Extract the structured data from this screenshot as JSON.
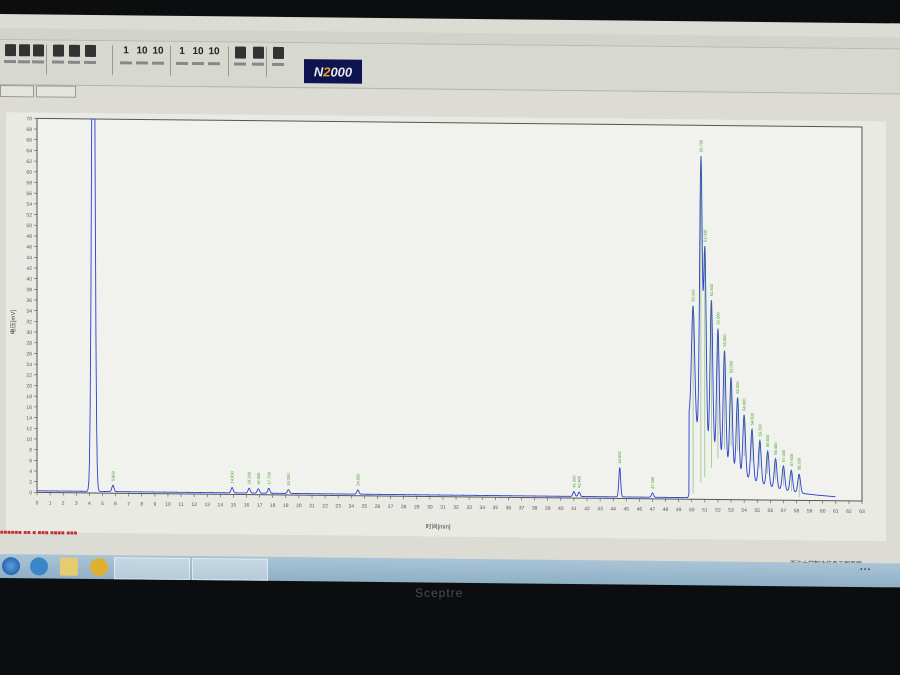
{
  "app": {
    "logo": "N2000"
  },
  "tabs": [
    "",
    ""
  ],
  "chart_data": {
    "type": "line",
    "xlabel": "时间[min]",
    "ylabel": "电压[mV]",
    "xlim": [
      0,
      63
    ],
    "ylim": [
      0,
      70
    ],
    "xticks": [
      0,
      1,
      2,
      3,
      4,
      5,
      6,
      7,
      8,
      9,
      10,
      11,
      12,
      13,
      14,
      15,
      16,
      17,
      18,
      19,
      20,
      21,
      22,
      23,
      24,
      25,
      26,
      27,
      28,
      29,
      30,
      31,
      32,
      33,
      34,
      35,
      36,
      37,
      38,
      39,
      40,
      41,
      42,
      43,
      44,
      45,
      46,
      47,
      48,
      49,
      50,
      51,
      52,
      53,
      54,
      55,
      56,
      57,
      58,
      59,
      60,
      61,
      62,
      63
    ],
    "ytick_step": 2,
    "line_color": "#2c3fd0",
    "label_color": "#3a9a20",
    "peaks": [
      {
        "rt": 4.3,
        "height": 120,
        "width": 0.12
      },
      {
        "rt": 5.8,
        "height": 1.2,
        "width": 0.08
      },
      {
        "rt": 14.9,
        "height": 1.0,
        "width": 0.08
      },
      {
        "rt": 16.2,
        "height": 0.9,
        "width": 0.08
      },
      {
        "rt": 16.9,
        "height": 0.8,
        "width": 0.08
      },
      {
        "rt": 17.7,
        "height": 0.9,
        "width": 0.08
      },
      {
        "rt": 19.2,
        "height": 0.7,
        "width": 0.08
      },
      {
        "rt": 24.5,
        "height": 0.8,
        "width": 0.08
      },
      {
        "rt": 41.0,
        "height": 0.9,
        "width": 0.08
      },
      {
        "rt": 41.4,
        "height": 0.8,
        "width": 0.08
      },
      {
        "rt": 44.5,
        "height": 5.5,
        "width": 0.07
      },
      {
        "rt": 47.0,
        "height": 0.8,
        "width": 0.08
      },
      {
        "rt": 50.1,
        "height": 22,
        "width": 0.12
      },
      {
        "rt": 50.7,
        "height": 52,
        "width": 0.1
      },
      {
        "rt": 51.0,
        "height": 36,
        "width": 0.1
      },
      {
        "rt": 51.5,
        "height": 28,
        "width": 0.1
      },
      {
        "rt": 52.0,
        "height": 24,
        "width": 0.1
      },
      {
        "rt": 52.5,
        "height": 21,
        "width": 0.1
      },
      {
        "rt": 53.0,
        "height": 17,
        "width": 0.1
      },
      {
        "rt": 53.5,
        "height": 14,
        "width": 0.1
      },
      {
        "rt": 54.0,
        "height": 11.5,
        "width": 0.1
      },
      {
        "rt": 54.6,
        "height": 9.5,
        "width": 0.1
      },
      {
        "rt": 55.2,
        "height": 8,
        "width": 0.1
      },
      {
        "rt": 55.8,
        "height": 6.5,
        "width": 0.1
      },
      {
        "rt": 56.4,
        "height": 5.5,
        "width": 0.1
      },
      {
        "rt": 57.0,
        "height": 4.5,
        "width": 0.1
      },
      {
        "rt": 57.6,
        "height": 4,
        "width": 0.1
      },
      {
        "rt": 58.2,
        "height": 3.5,
        "width": 0.1
      }
    ]
  },
  "taskbar": {
    "corp_text": "浙江大学智达信息工程有限",
    "brand": "Sceptre"
  }
}
